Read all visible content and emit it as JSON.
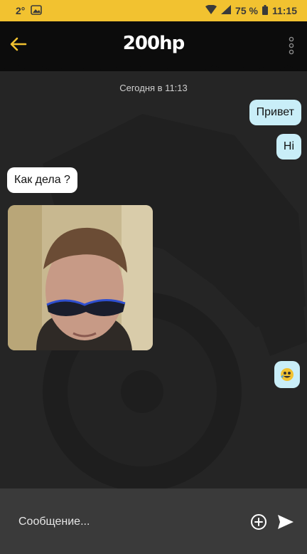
{
  "status_bar": {
    "temperature": "2°",
    "battery_percent": "75 %",
    "time": "11:15"
  },
  "header": {
    "title": "200hp"
  },
  "chat": {
    "date_label": "Сегодня в 11:13",
    "messages": [
      {
        "direction": "outgoing",
        "text": "Привет"
      },
      {
        "direction": "outgoing",
        "text": "Hi"
      },
      {
        "direction": "incoming",
        "text": "Как дела ?"
      },
      {
        "direction": "incoming",
        "type": "photo"
      },
      {
        "direction": "outgoing",
        "type": "sticker"
      }
    ]
  },
  "composer": {
    "placeholder": "Сообщение..."
  },
  "colors": {
    "status_bar": "#f2c230",
    "accent_yellow": "#f2c230",
    "outgoing_bubble": "#c9eef8",
    "incoming_bubble": "#ffffff",
    "header": "#0c0c0c",
    "input_bar": "#3a3a3a"
  }
}
